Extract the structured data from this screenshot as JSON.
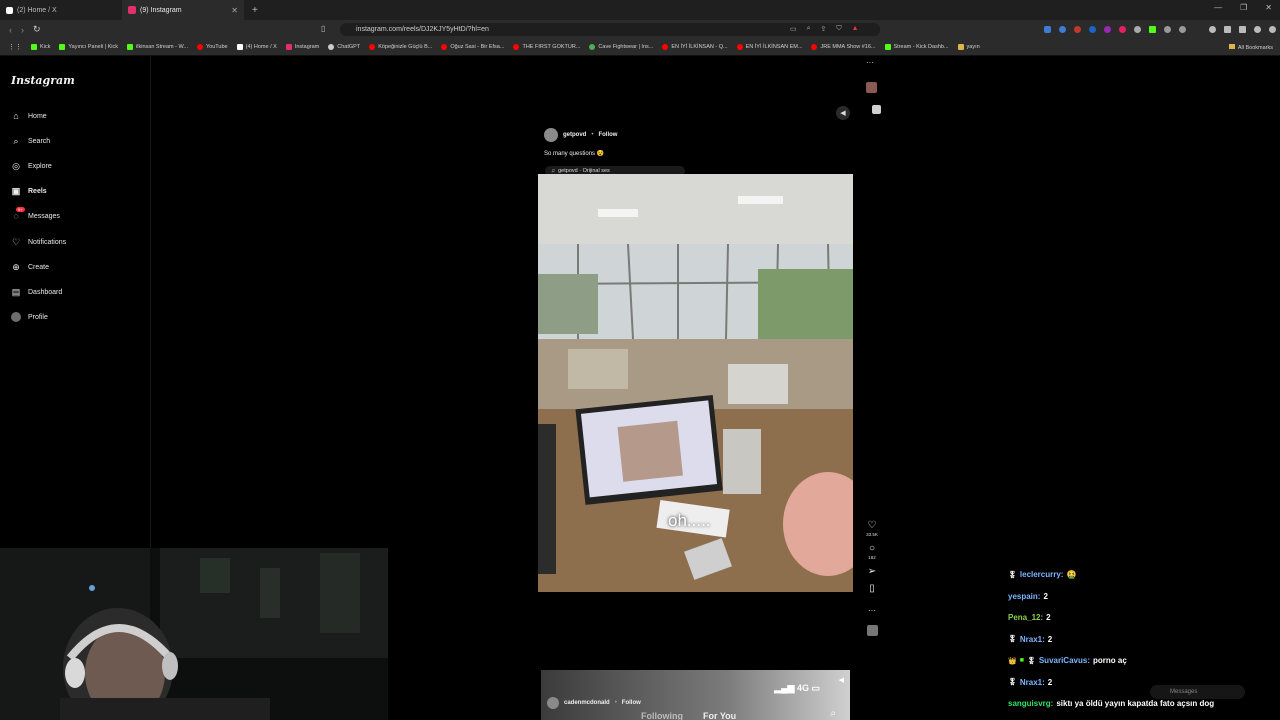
{
  "browser": {
    "tabs": [
      {
        "label": "(2) Home / X",
        "active": false
      },
      {
        "label": "(9) Instagram",
        "active": true
      }
    ],
    "url": "instagram.com/reels/DJ2KJY5yHtD/?hl=en",
    "bookmarks": [
      {
        "label": "Kick",
        "color": "#53fc18"
      },
      {
        "label": "Yayıncı Paneli | Kick",
        "color": "#53fc18"
      },
      {
        "label": "ilkinsan Stream - W...",
        "color": "#53fc18"
      },
      {
        "label": "YouTube",
        "color": "#ff0000"
      },
      {
        "label": "(4) Home / X",
        "color": "#ffffff"
      },
      {
        "label": "Instagram",
        "color": "#e1306c"
      },
      {
        "label": "ChatGPT",
        "color": "#cccccc"
      },
      {
        "label": "Köpeğinizle Güçlü B...",
        "color": "#ff0000"
      },
      {
        "label": "Oğuz Sasi - Bir Efsa...",
        "color": "#ff0000"
      },
      {
        "label": "THE FIRST GOKTUR...",
        "color": "#ff0000"
      },
      {
        "label": "Cave Fightwear | Ins...",
        "color": "#4caf50"
      },
      {
        "label": "EN İYİ İLKİNSAN - Q...",
        "color": "#ff0000"
      },
      {
        "label": "EN İYİ İLKİNSAN EM...",
        "color": "#ff0000"
      },
      {
        "label": "JRE MMA Show #16...",
        "color": "#ff0000"
      },
      {
        "label": "Stream - Kick Dashb...",
        "color": "#53fc18"
      },
      {
        "label": "yayın",
        "color": "#e0b34a"
      }
    ],
    "all_bookmarks": "All Bookmarks"
  },
  "sidebar": {
    "logo": "Instagram",
    "items": [
      {
        "label": "Home",
        "icon": "home-icon",
        "glyph": "⌂"
      },
      {
        "label": "Search",
        "icon": "search-icon",
        "glyph": "⌕"
      },
      {
        "label": "Explore",
        "icon": "compass-icon",
        "glyph": "◎"
      },
      {
        "label": "Reels",
        "icon": "reels-icon",
        "glyph": "▣"
      },
      {
        "label": "Messages",
        "icon": "messenger-icon",
        "glyph": "◌",
        "badge": "9+"
      },
      {
        "label": "Notifications",
        "icon": "heart-icon",
        "glyph": "♡"
      },
      {
        "label": "Create",
        "icon": "plus-square-icon",
        "glyph": "⊕"
      },
      {
        "label": "Dashboard",
        "icon": "dashboard-icon",
        "glyph": "▤"
      },
      {
        "label": "Profile",
        "icon": "avatar-icon",
        "glyph": ""
      }
    ]
  },
  "reel": {
    "username": "getpovd",
    "follow": "Follow",
    "caption": "So many questions 😵",
    "audio": "getpovd · Orijinal ses",
    "subtitle": "oh.....",
    "likes": "33.5K",
    "comments": "182"
  },
  "next_reel": {
    "username": "cadenmcdonald",
    "follow": "Follow",
    "status": "4G",
    "tabs": [
      "Following",
      "For You"
    ]
  },
  "chat": [
    {
      "user": "leclercurry:",
      "msg": "🤮",
      "style": "blue2"
    },
    {
      "user": "yespain:",
      "msg": "2",
      "style": "blue2"
    },
    {
      "user": "Pena_12:",
      "msg": "2",
      "style": "lime"
    },
    {
      "user": "Nrax1:",
      "msg": "2",
      "style": "blue2"
    },
    {
      "user": "SuvariCavus:",
      "msg": "porno aç",
      "style": "blue2"
    },
    {
      "user": "Nrax1:",
      "msg": "2",
      "style": "blue2"
    },
    {
      "user": "sanguisvrg:",
      "msg": "siktı ya öldü yayın kapatda fato açsın dog",
      "style": "green"
    }
  ],
  "messages_chip": "Messages"
}
